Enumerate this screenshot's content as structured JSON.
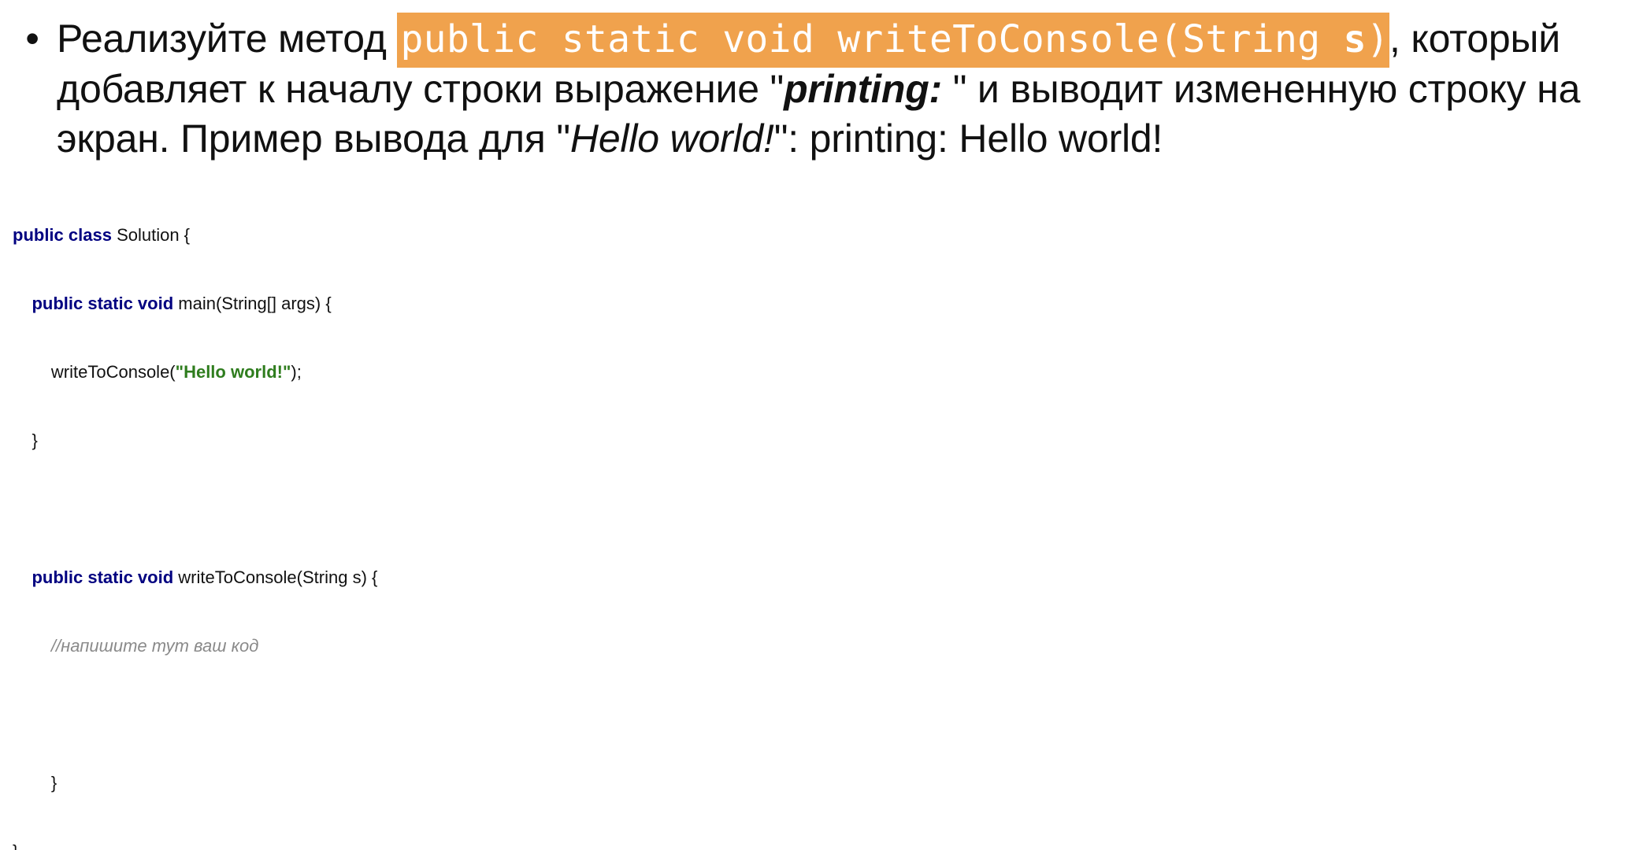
{
  "task": {
    "bullet": "•",
    "intro": "Реализуйте метод ",
    "method_code_main": "public static void writeToConsole(String ",
    "method_code_param": "s",
    "method_code_end": ")",
    "text_after_method": ", который добавляет к началу строки выражение \"",
    "prefix_bold_italic": "printing:",
    "text_after_prefix": " \" и выводит измененную строку на экран. Пример вывода для \"",
    "example_input_italic": "Hello world!",
    "text_after_example": "\": printing: Hello world!"
  },
  "code": {
    "line1_kw": "public class",
    "line1_rest": " Solution {",
    "line2_indent": "    ",
    "line2_kw": "public static void",
    "line2_rest": " main(String[] args) {",
    "line3_indent": "        ",
    "line3_call": "writeToConsole(",
    "line3_string": "\"Hello world!\"",
    "line3_end": ");",
    "line4": "    }",
    "line5": "",
    "line6_indent": "    ",
    "line6_kw": "public static void",
    "line6_rest": " writeToConsole(String s) {",
    "line7_indent": "        ",
    "line7_comment": "//напишите тут ваш код",
    "line8": "",
    "line9": "        }",
    "line10": "}"
  },
  "colors": {
    "highlight_background": "#f0a24d",
    "keyword": "#000080",
    "string_literal": "#2f7d1e",
    "comment": "#8a8a8a"
  }
}
